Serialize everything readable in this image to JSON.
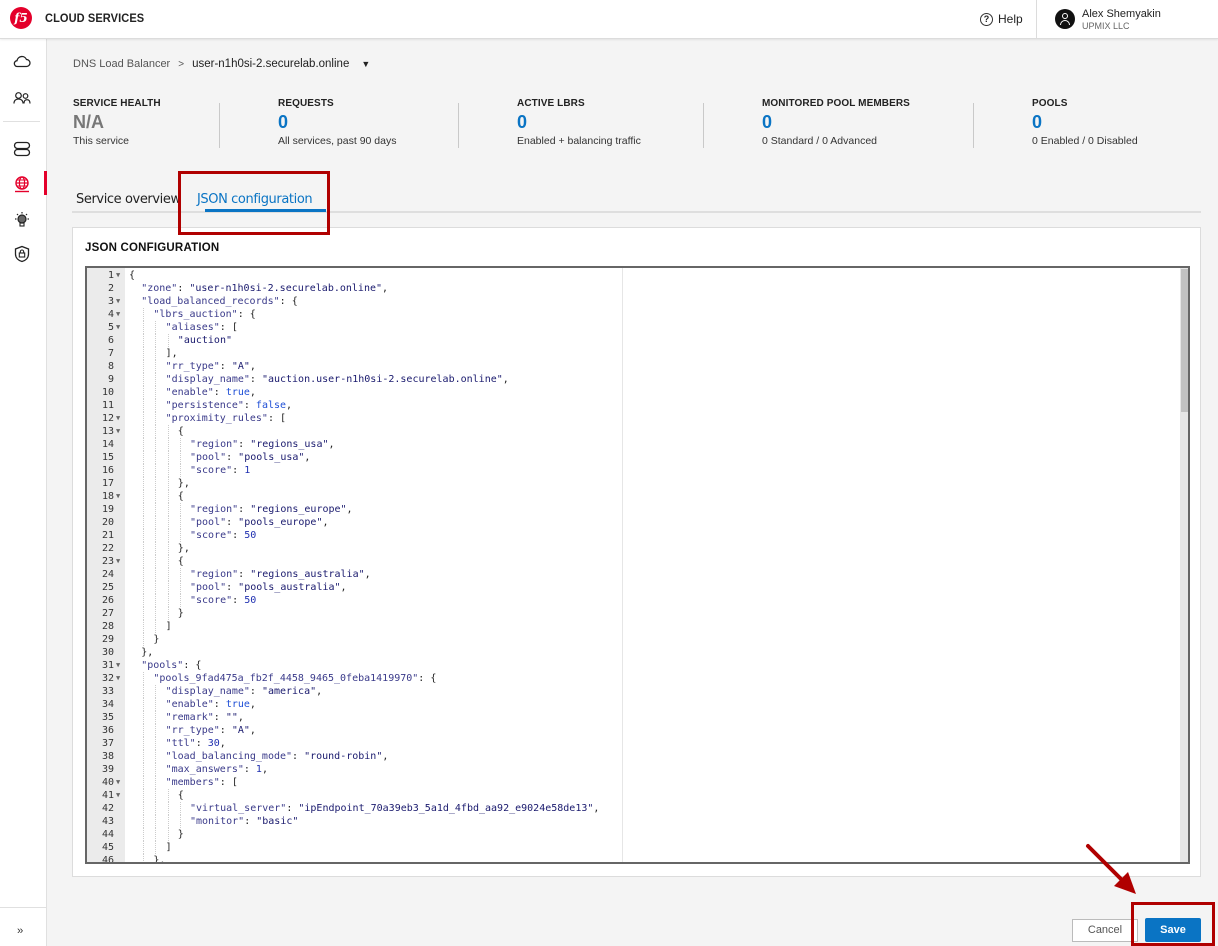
{
  "header": {
    "app_title": "CLOUD SERVICES",
    "help_label": "Help",
    "user_name": "Alex Shemyakin",
    "user_org": "UPMIX LLC"
  },
  "sidebar": {
    "items": [
      {
        "icon": "cloud-icon",
        "active": false
      },
      {
        "icon": "users-icon",
        "active": false
      },
      {
        "icon": "server-stack-icon",
        "active": false
      },
      {
        "icon": "globe-icon",
        "active": true
      },
      {
        "icon": "lightbulb-icon",
        "active": false
      },
      {
        "icon": "shield-lock-icon",
        "active": false
      }
    ],
    "expand_label": "››",
    "accent_color": "#e4002b"
  },
  "breadcrumb": {
    "root": "DNS Load Balancer",
    "separator": ">",
    "current": "user-n1h0si-2.securelab.online",
    "caret": "▼"
  },
  "stats": [
    {
      "label": "SERVICE HEALTH",
      "value": "N/A",
      "sub": "This service"
    },
    {
      "label": "REQUESTS",
      "value": "0",
      "sub": "All services, past 90 days"
    },
    {
      "label": "ACTIVE LBRS",
      "value": "0",
      "sub": "Enabled + balancing traffic"
    },
    {
      "label": "MONITORED POOL MEMBERS",
      "value": "0",
      "sub": "0 Standard / 0 Advanced"
    },
    {
      "label": "POOLS",
      "value": "0",
      "sub": "0 Enabled / 0 Disabled"
    }
  ],
  "tabs": [
    {
      "label": "Service overview",
      "active": false
    },
    {
      "label": "JSON configuration",
      "active": true
    }
  ],
  "card": {
    "title": "JSON CONFIGURATION"
  },
  "editor": {
    "lines": [
      {
        "n": 1,
        "fold": true,
        "indent": 0,
        "text": "{"
      },
      {
        "n": 2,
        "fold": false,
        "indent": 1,
        "text": "\"zone\": \"user-n1h0si-2.securelab.online\","
      },
      {
        "n": 3,
        "fold": true,
        "indent": 1,
        "text": "\"load_balanced_records\": {"
      },
      {
        "n": 4,
        "fold": true,
        "indent": 2,
        "text": "\"lbrs_auction\": {"
      },
      {
        "n": 5,
        "fold": true,
        "indent": 3,
        "text": "\"aliases\": ["
      },
      {
        "n": 6,
        "fold": false,
        "indent": 4,
        "text": "\"auction\""
      },
      {
        "n": 7,
        "fold": false,
        "indent": 3,
        "text": "],"
      },
      {
        "n": 8,
        "fold": false,
        "indent": 3,
        "text": "\"rr_type\": \"A\","
      },
      {
        "n": 9,
        "fold": false,
        "indent": 3,
        "text": "\"display_name\": \"auction.user-n1h0si-2.securelab.online\","
      },
      {
        "n": 10,
        "fold": false,
        "indent": 3,
        "text": "\"enable\": true,"
      },
      {
        "n": 11,
        "fold": false,
        "indent": 3,
        "text": "\"persistence\": false,"
      },
      {
        "n": 12,
        "fold": true,
        "indent": 3,
        "text": "\"proximity_rules\": ["
      },
      {
        "n": 13,
        "fold": true,
        "indent": 4,
        "text": "{"
      },
      {
        "n": 14,
        "fold": false,
        "indent": 5,
        "text": "\"region\": \"regions_usa\","
      },
      {
        "n": 15,
        "fold": false,
        "indent": 5,
        "text": "\"pool\": \"pools_usa\","
      },
      {
        "n": 16,
        "fold": false,
        "indent": 5,
        "text": "\"score\": 1"
      },
      {
        "n": 17,
        "fold": false,
        "indent": 4,
        "text": "},"
      },
      {
        "n": 18,
        "fold": true,
        "indent": 4,
        "text": "{"
      },
      {
        "n": 19,
        "fold": false,
        "indent": 5,
        "text": "\"region\": \"regions_europe\","
      },
      {
        "n": 20,
        "fold": false,
        "indent": 5,
        "text": "\"pool\": \"pools_europe\","
      },
      {
        "n": 21,
        "fold": false,
        "indent": 5,
        "text": "\"score\": 50"
      },
      {
        "n": 22,
        "fold": false,
        "indent": 4,
        "text": "},"
      },
      {
        "n": 23,
        "fold": true,
        "indent": 4,
        "text": "{"
      },
      {
        "n": 24,
        "fold": false,
        "indent": 5,
        "text": "\"region\": \"regions_australia\","
      },
      {
        "n": 25,
        "fold": false,
        "indent": 5,
        "text": "\"pool\": \"pools_australia\","
      },
      {
        "n": 26,
        "fold": false,
        "indent": 5,
        "text": "\"score\": 50"
      },
      {
        "n": 27,
        "fold": false,
        "indent": 4,
        "text": "}"
      },
      {
        "n": 28,
        "fold": false,
        "indent": 3,
        "text": "]"
      },
      {
        "n": 29,
        "fold": false,
        "indent": 2,
        "text": "}"
      },
      {
        "n": 30,
        "fold": false,
        "indent": 1,
        "text": "},"
      },
      {
        "n": 31,
        "fold": true,
        "indent": 1,
        "text": "\"pools\": {"
      },
      {
        "n": 32,
        "fold": true,
        "indent": 2,
        "text": "\"pools_9fad475a_fb2f_4458_9465_0feba1419970\": {"
      },
      {
        "n": 33,
        "fold": false,
        "indent": 3,
        "text": "\"display_name\": \"america\","
      },
      {
        "n": 34,
        "fold": false,
        "indent": 3,
        "text": "\"enable\": true,"
      },
      {
        "n": 35,
        "fold": false,
        "indent": 3,
        "text": "\"remark\": \"\","
      },
      {
        "n": 36,
        "fold": false,
        "indent": 3,
        "text": "\"rr_type\": \"A\","
      },
      {
        "n": 37,
        "fold": false,
        "indent": 3,
        "text": "\"ttl\": 30,"
      },
      {
        "n": 38,
        "fold": false,
        "indent": 3,
        "text": "\"load_balancing_mode\": \"round-robin\","
      },
      {
        "n": 39,
        "fold": false,
        "indent": 3,
        "text": "\"max_answers\": 1,"
      },
      {
        "n": 40,
        "fold": true,
        "indent": 3,
        "text": "\"members\": ["
      },
      {
        "n": 41,
        "fold": true,
        "indent": 4,
        "text": "{"
      },
      {
        "n": 42,
        "fold": false,
        "indent": 5,
        "text": "\"virtual_server\": \"ipEndpoint_70a39eb3_5a1d_4fbd_aa92_e9024e58de13\","
      },
      {
        "n": 43,
        "fold": false,
        "indent": 5,
        "text": "\"monitor\": \"basic\""
      },
      {
        "n": 44,
        "fold": false,
        "indent": 4,
        "text": "}"
      },
      {
        "n": 45,
        "fold": false,
        "indent": 3,
        "text": "]"
      },
      {
        "n": 46,
        "fold": false,
        "indent": 2,
        "text": "},"
      }
    ]
  },
  "actions": {
    "cancel_label": "Cancel",
    "save_label": "Save"
  },
  "colors": {
    "primary": "#0a74c4",
    "brand_red": "#e4002b",
    "annotation_red": "#b00000"
  }
}
